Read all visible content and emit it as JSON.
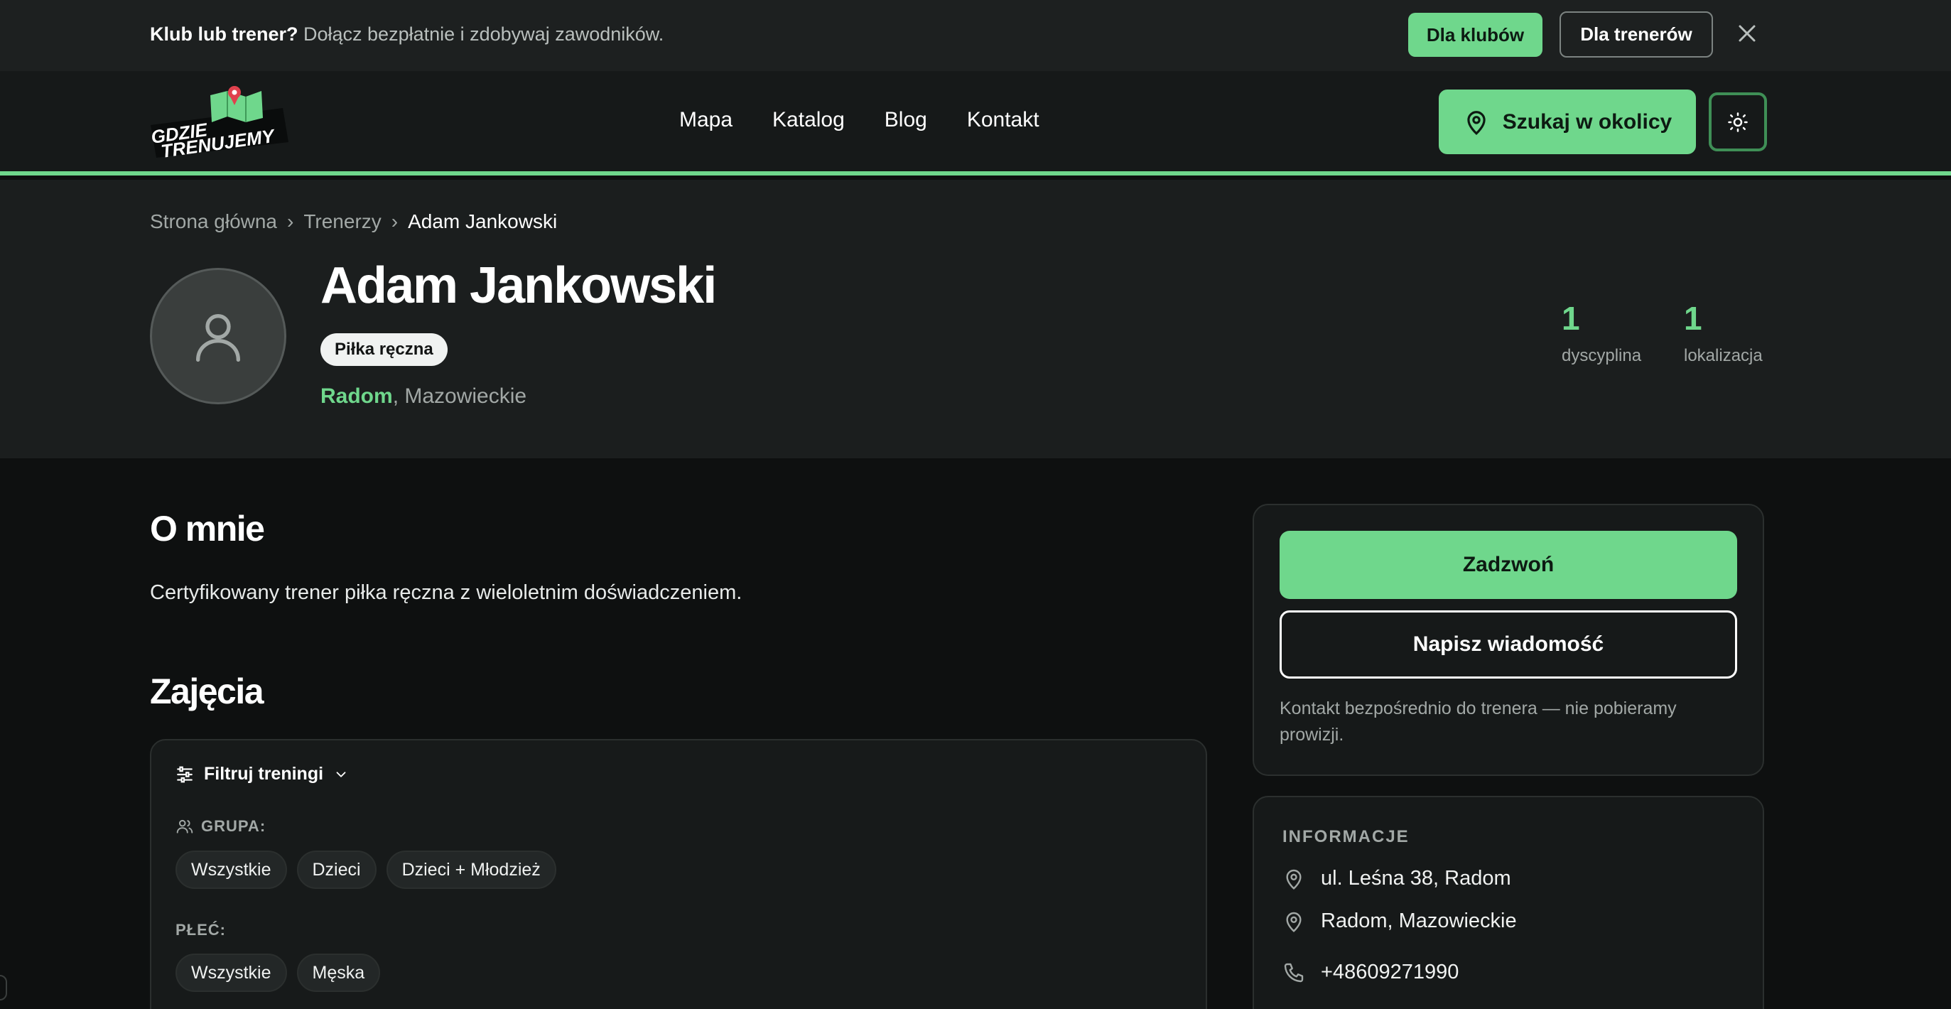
{
  "announcement": {
    "bold": "Klub lub trener?",
    "text": " Dołącz bezpłatnie i zdobywaj zawodników.",
    "btn_clubs": "Dla klubów",
    "btn_trainers": "Dla trenerów",
    "close_icon": "close-icon"
  },
  "header": {
    "logo_text_line1": "GDZIE",
    "logo_text_line2": "TRENUJEMY",
    "nav": [
      "Mapa",
      "Katalog",
      "Blog",
      "Kontakt"
    ],
    "search_label": "Szukaj w okolicy",
    "theme_icon": "sun-icon"
  },
  "breadcrumb": {
    "home": "Strona główna",
    "section": "Trenerzy",
    "current": "Adam Jankowski",
    "separator": "›"
  },
  "profile": {
    "name": "Adam Jankowski",
    "discipline": "Piłka ręczna",
    "city": "Radom",
    "region": ", Mazowieckie",
    "stats": [
      {
        "value": "1",
        "label": "dyscyplina"
      },
      {
        "value": "1",
        "label": "lokalizacja"
      }
    ]
  },
  "about": {
    "title": "O mnie",
    "text": "Certyfikowany trener piłka ręczna z wieloletnim doświadczeniem."
  },
  "classes": {
    "title": "Zajęcia",
    "filter_toggle": "Filtruj treningi",
    "group_label": "GRUPA:",
    "group_options": [
      "Wszystkie",
      "Dzieci",
      "Dzieci + Młodzież"
    ],
    "gender_label": "PŁEĆ:",
    "gender_options": [
      "Wszystkie",
      "Męska"
    ]
  },
  "contact": {
    "call": "Zadzwoń",
    "message": "Napisz wiadomość",
    "note": "Kontakt bezpośrednio do trenera — nie pobieramy prowizji."
  },
  "info": {
    "title": "INFORMACJE",
    "address": "ul. Leśna 38, Radom",
    "location": "Radom, Mazowieckie",
    "phone": "+48609271990"
  },
  "colors": {
    "accent": "#6fd78c",
    "background": "#0e1010",
    "surface": "#1b1e1e"
  }
}
